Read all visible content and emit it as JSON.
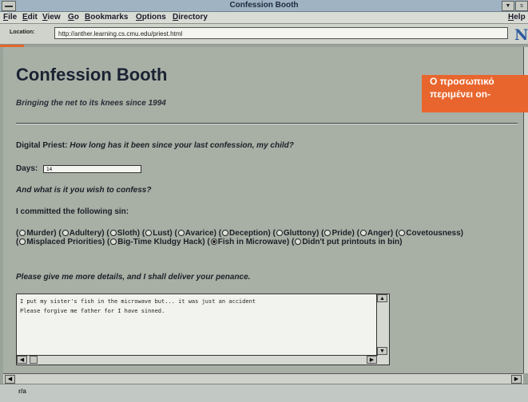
{
  "window": {
    "title": "Confession Booth",
    "right_button_label": "▼",
    "right_button_2_label": "s"
  },
  "menubar": {
    "items": [
      "File",
      "Edit",
      "View",
      "Go",
      "Bookmarks",
      "Options",
      "Directory"
    ],
    "help": "Help"
  },
  "location": {
    "label": "Location:",
    "url": "http://anther.learning.cs.cmu.edu/priest.html"
  },
  "page": {
    "title": "Confession Booth",
    "tagline": "Bringing the net to its knees since 1994",
    "priest_label": "Digital Priest:",
    "priest_question": "How long has it been since your last confession, my child?",
    "days_label": "Days:",
    "days_value": "14",
    "confess_prompt": "And what is it you wish to confess?",
    "sin_intro": "I committed the following sin:",
    "sins": [
      {
        "label": "Murder",
        "selected": false
      },
      {
        "label": "Adultery",
        "selected": false
      },
      {
        "label": "Sloth",
        "selected": false
      },
      {
        "label": "Lust",
        "selected": false
      },
      {
        "label": "Avarice",
        "selected": false
      },
      {
        "label": "Deception",
        "selected": false
      },
      {
        "label": "Gluttony",
        "selected": false
      },
      {
        "label": "Pride",
        "selected": false
      },
      {
        "label": "Anger",
        "selected": false
      },
      {
        "label": "Covetousness",
        "selected": false
      },
      {
        "label": "Misplaced Priorities",
        "selected": false
      },
      {
        "label": "Big-Time Kludgy Hack",
        "selected": false
      },
      {
        "label": "Fish in Microwave",
        "selected": true
      },
      {
        "label": "Didn't put printouts in bin",
        "selected": false
      }
    ],
    "details_prompt": "Please give me more details, and I shall deliver your penance.",
    "details_text": "I put my sister's fish in the microwave but... it was just an accident\nPlease forgive me father for I have sinned."
  },
  "overlay": {
    "line1": "Ο προσωπικό",
    "line2": "περιμένει on-"
  },
  "status": {
    "icon_text": "r/a"
  },
  "colors": {
    "accent": "#e8652d",
    "page_bg": "#a8b0a6"
  }
}
